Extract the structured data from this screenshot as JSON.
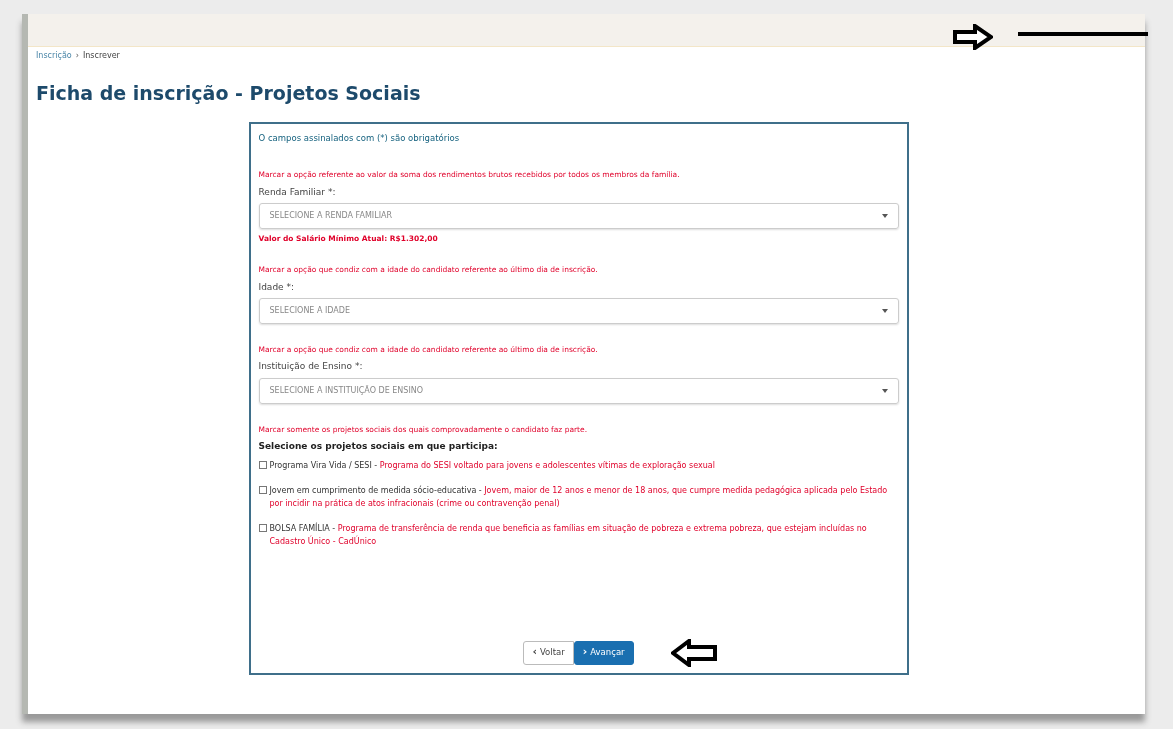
{
  "breadcrumb": [
    "Inscrição",
    "Inscrever"
  ],
  "title": "Ficha de inscrição - Projetos Sociais",
  "form": {
    "required_note": "O campos assinalados com (*) são obrigatórios",
    "fields": [
      {
        "hint": "Marcar a opção referente ao valor da soma dos rendimentos brutos recebidos por todos os membros da família.",
        "label": "Renda Familiar *:",
        "placeholder": "SELECIONE A RENDA FAMILIAR",
        "note": "Valor do Salário Mínimo Atual: R$1.302,00"
      },
      {
        "hint": "Marcar a opção que condiz com a idade do candidato referente ao último dia de inscrição.",
        "label": "Idade *:",
        "placeholder": "SELECIONE A IDADE"
      },
      {
        "hint": "Marcar a opção que condiz com a idade do candidato referente ao último dia de inscrição.",
        "label": "Instituição de Ensino *:",
        "placeholder": "SELECIONE A INSTITUIÇÃO DE ENSINO"
      }
    ],
    "projects_hint": "Marcar somente os projetos sociais dos quais comprovadamente o candidato faz parte.",
    "projects_label": "Selecione os projetos sociais em que participa:",
    "projects": [
      {
        "name": "Programa Vira Vida / SESI -",
        "description": "Programa do SESI voltado para jovens e adolescentes vítimas de exploração sexual",
        "checked": false
      },
      {
        "name": "Jovem em cumprimento de medida sócio-educativa -",
        "description": "Jovem, maior de 12 anos e menor de 18 anos, que cumpre medida pedagógica aplicada pelo Estado por incidir na prática de atos infracionais (crime ou contravenção penal)",
        "checked": false
      },
      {
        "name": "BOLSA FAMÍLIA -",
        "description": "Programa de transferência de renda que beneficia as famílias em situação de pobreza e extrema pobreza, que estejam incluídas no Cadastro Único - CadÚnico",
        "checked": false
      }
    ],
    "buttons": [
      {
        "label": "Voltar",
        "kind": "secondary",
        "icon": "‹"
      },
      {
        "label": "Avançar",
        "kind": "primary",
        "icon": "›"
      }
    ]
  }
}
